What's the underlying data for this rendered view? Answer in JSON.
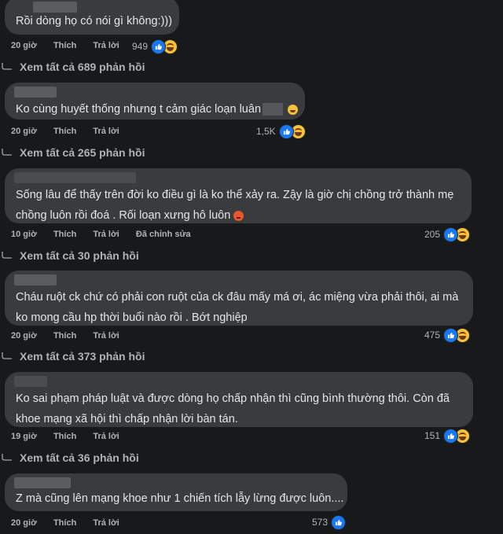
{
  "colors": {
    "background": "#18191a",
    "bubble": "#3a3b3c",
    "text": "#e4e6eb",
    "muted": "#b0b3b8",
    "like": "#1877f2",
    "haha": "#f7c23a",
    "angry": "#e8582c"
  },
  "comments": [
    {
      "text_lines": [
        "Rồi dòng họ có nói gì không:)))"
      ],
      "time": "20 giờ",
      "like": "Thích",
      "reply": "Trả lời",
      "reactions": "949",
      "reaction_icons": [
        "like-icon",
        "haha-icon"
      ]
    },
    {
      "text_lines": [
        "Ko cùng huyết thống nhưng t cảm giác loạn luân"
      ],
      "time": "20 giờ",
      "like": "Thích",
      "reply": "Trả lời",
      "reactions": "1,5K",
      "reaction_icons": [
        "like-icon",
        "haha-icon"
      ],
      "inline_emoji": "grinning-emoji"
    },
    {
      "text_lines": [
        "Sống lâu để thấy trên đời ko điều gì là ko thể xảy ra. Zậy là giờ chị chồng trở thành mẹ",
        "chồng luôn rồi đoá . Rối loạn xưng hô luôn"
      ],
      "time": "10 giờ",
      "like": "Thích",
      "reply": "Trả lời",
      "edited": "Đã chỉnh sửa",
      "reactions": "205",
      "reaction_icons": [
        "like-icon",
        "haha-icon"
      ],
      "inline_emoji": "angry-emoji"
    },
    {
      "text_lines": [
        "Cháu ruột ck chứ có phải con ruột của ck đâu mấy má ơi, ác miệng vừa phải thôi, ai mà",
        "ko mong cầu hp thời buổi nào rồi . Bớt nghiệp"
      ],
      "time": "20 giờ",
      "like": "Thích",
      "reply": "Trả lời",
      "reactions": "475",
      "reaction_icons": [
        "like-icon",
        "haha-icon"
      ]
    },
    {
      "text_lines": [
        "Ko sai phạm pháp luật và được dòng họ chấp nhận thì cũng bình thường thôi. Còn đã",
        "khoe mạng xã hội thì chấp nhận lời bàn tán."
      ],
      "time": "19 giờ",
      "like": "Thích",
      "reply": "Trả lời",
      "reactions": "151",
      "reaction_icons": [
        "like-icon",
        "haha-icon"
      ]
    },
    {
      "text_lines": [
        "Z mà cũng lên mạng khoe như 1 chiến tích lẫy lừng được luôn...."
      ],
      "time": "20 giờ",
      "like": "Thích",
      "reply": "Trả lời",
      "reactions": "573",
      "reaction_icons": [
        "like-icon"
      ]
    }
  ],
  "view_replies": [
    "Xem tất cả 689 phản hồi",
    "Xem tất cả 265 phản hồi",
    "Xem tất cả 30 phản hồi",
    "Xem tất cả 373 phản hồi",
    "Xem tất cả 36 phản hồi"
  ]
}
